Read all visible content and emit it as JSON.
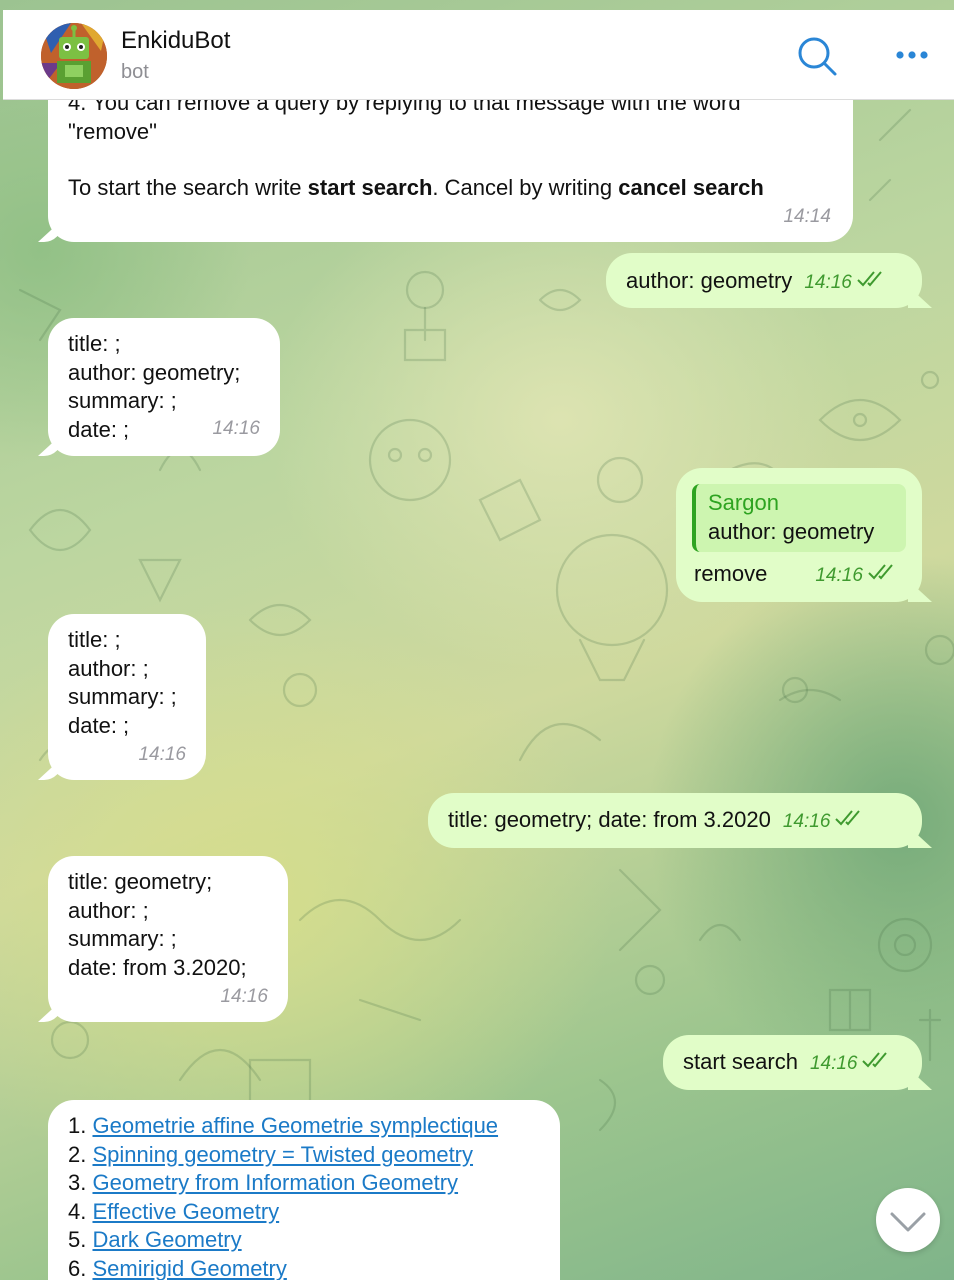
{
  "header": {
    "bot_name": "EnkiduBot",
    "bot_status": "bot",
    "search_icon": "search-icon",
    "more_icon": "more-horizontal-icon"
  },
  "colors": {
    "incoming_bubble": "#ffffff",
    "outgoing_bubble": "#e1fdc8",
    "accent_green": "#3f9a2f",
    "link_blue": "#1b7ac7",
    "header_icon_blue": "#2a86d6"
  },
  "messages": [
    {
      "direction": "in",
      "lines": [
        "4. You can remove a query by replying to that message with the word",
        "\"remove\""
      ],
      "instruction_prefix": "To start the search write ",
      "instruction_cmd1": "start search",
      "instruction_mid": ". Cancel by writing ",
      "instruction_cmd2": "cancel search",
      "time": "14:14"
    },
    {
      "direction": "out",
      "text": "author: geometry",
      "time": "14:16"
    },
    {
      "direction": "in",
      "lines": [
        "title: ;",
        "author: geometry;",
        "summary: ;",
        "date: ;"
      ],
      "time": "14:16"
    },
    {
      "direction": "out",
      "reply_author": "Sargon",
      "reply_text": "author: geometry",
      "text": "remove",
      "time": "14:16"
    },
    {
      "direction": "in",
      "lines": [
        "title: ;",
        "author: ;",
        "summary: ;",
        "date: ;"
      ],
      "time": "14:16"
    },
    {
      "direction": "out",
      "text": "title: geometry; date: from 3.2020",
      "time": "14:16"
    },
    {
      "direction": "in",
      "lines": [
        "title: geometry;",
        "author: ;",
        "summary: ;",
        "date: from 3.2020;"
      ],
      "time": "14:16"
    },
    {
      "direction": "out",
      "text": "start search",
      "time": "14:16"
    },
    {
      "direction": "in",
      "results": [
        {
          "num": "1.",
          "title": "Geometrie affine Geometrie symplectique"
        },
        {
          "num": "2.",
          "title": "Spinning geometry = Twisted geometry"
        },
        {
          "num": "3.",
          "title": "Geometry from Information Geometry"
        },
        {
          "num": "4.",
          "title": "Effective Geometry"
        },
        {
          "num": "5.",
          "title": "Dark Geometry"
        },
        {
          "num": "6.",
          "title": "Semirigid Geometry"
        }
      ]
    }
  ],
  "scroll_button_icon": "chevron-down-icon"
}
